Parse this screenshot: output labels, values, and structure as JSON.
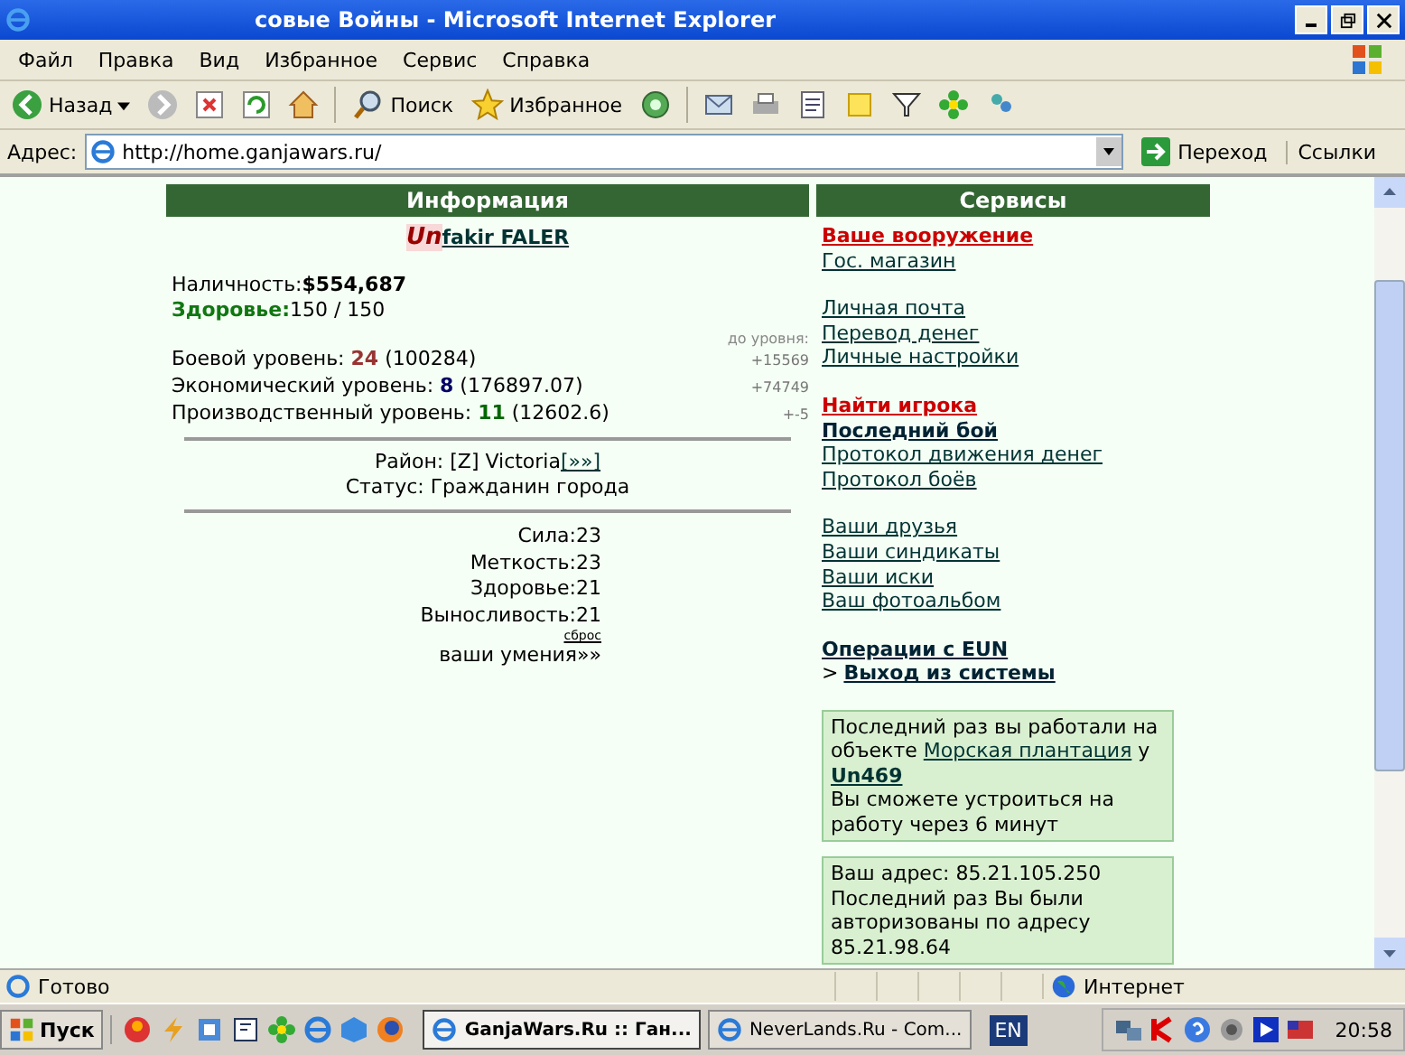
{
  "window": {
    "title": "совые Войны - Microsoft Internet Explorer"
  },
  "menu": [
    {
      "label": "Файл"
    },
    {
      "label": "Правка"
    },
    {
      "label": "Вид"
    },
    {
      "label": "Избранное"
    },
    {
      "label": "Сервис"
    },
    {
      "label": "Справка"
    }
  ],
  "toolbar": {
    "back": "Назад",
    "search": "Поиск",
    "favorites": "Избранное"
  },
  "address": {
    "label": "Адрес:",
    "value": "http://home.ganjawars.ru/",
    "go": "Переход",
    "links": "Ссылки"
  },
  "info": {
    "title": "Информация",
    "clan": "Un",
    "player": "fakir FALER",
    "cash_label": "Наличность:",
    "cash": "$554,687",
    "health_label": "Здоровье:",
    "health": "150 / 150",
    "to_level": "до уровня:",
    "levels": [
      {
        "label": "Боевой уровень:",
        "value": "24",
        "points": "(100284)",
        "to_next": "+15569",
        "color": "#993333"
      },
      {
        "label": "Экономический уровень:",
        "value": "8",
        "points": "(176897.07)",
        "to_next": "+74749",
        "color": "#000066"
      },
      {
        "label": "Производственный уровень:",
        "value": "11",
        "points": "(12602.6)",
        "to_next": "+-5",
        "color": "#006600"
      }
    ],
    "district_label": "Район:",
    "district": "[Z] Victoria",
    "district_link": "[»»]",
    "status": "Статус: Гражданин города",
    "stats": [
      {
        "label": "Сила:",
        "value": "23"
      },
      {
        "label": "Меткость:",
        "value": "23"
      },
      {
        "label": "Здоровье:",
        "value": "21"
      },
      {
        "label": "Выносливость:",
        "value": "21"
      }
    ],
    "reset": "сброс",
    "skills": "ваши умения»»"
  },
  "services": {
    "title": "Сервисы",
    "groups": [
      [
        {
          "text": "Ваше вооружение",
          "kind": "alert"
        },
        {
          "text": "Гос. магазин",
          "kind": "normal"
        }
      ],
      [
        {
          "text": "Личная почта",
          "kind": "normal"
        },
        {
          "text": "Перевод денег",
          "kind": "normal"
        },
        {
          "text": "Личные настройки",
          "kind": "normal"
        }
      ],
      [
        {
          "text": "Найти игрока",
          "kind": "alert"
        },
        {
          "text": "Последний бой",
          "kind": "bold"
        },
        {
          "text": "Протокол движения денег",
          "kind": "normal"
        },
        {
          "text": "Протокол боёв",
          "kind": "normal"
        }
      ],
      [
        {
          "text": "Ваши друзья",
          "kind": "normal"
        },
        {
          "text": "Ваши синдикаты",
          "kind": "normal"
        },
        {
          "text": "Ваши иски",
          "kind": "normal"
        },
        {
          "text": "Ваш фотоальбом",
          "kind": "normal"
        }
      ],
      [
        {
          "text": "Операции с EUN",
          "kind": "bold"
        },
        {
          "text": "Выход из системы",
          "kind": "bold",
          "prefix": ">"
        }
      ]
    ],
    "work": {
      "text": "Последний раз вы работали на объекте",
      "object": "Морская плантация",
      "owner_prefix": "у",
      "owner": "Un469",
      "note": "Вы сможете устроиться на работу через 6 минут"
    },
    "login": {
      "address": "Ваш адрес: 85.21.105.250",
      "previous": "Последний раз Вы были авторизованы по адресу 85.21.98.64"
    }
  },
  "status_bar": {
    "text": "Готово",
    "zone": "Интернет"
  },
  "taskbar": {
    "start": "Пуск",
    "tasks": [
      {
        "label": "GanjaWars.Ru :: Ган...",
        "selected": true
      },
      {
        "label": "NeverLands.Ru - Com...",
        "selected": false
      }
    ],
    "lang": "EN",
    "clock": "20:58"
  }
}
